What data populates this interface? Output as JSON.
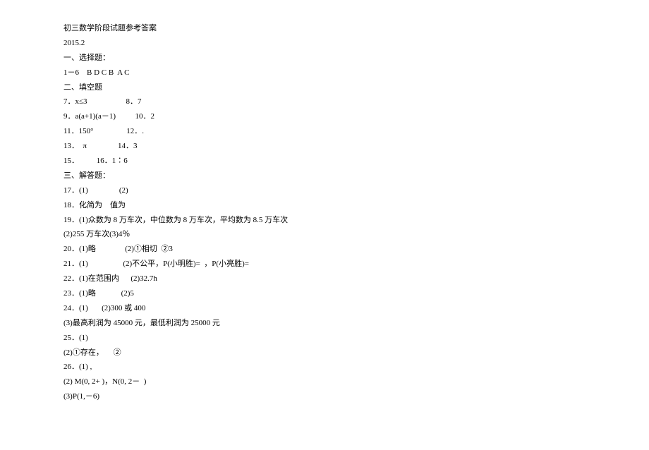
{
  "lines": [
    "初三数学阶段试题参考答案",
    "2015.2",
    "一、选择题：",
    "1－6    B D C B  A C",
    "二、填空题",
    "7．x≤3                    8．7",
    "9．a(a+1)(a－1)          10．2",
    "11．150°                 12．.",
    "13．  π                14．3",
    "15．         16．1∶6",
    "三、解答题：",
    "17．(1)                (2)",
    "18．化简为    值为",
    "19．(1)众数为 8 万车次，中位数为 8 万车次，平均数为 8.5 万车次",
    "(2)255 万车次(3)4％",
    "20．(1)略               (2)①相切  ②3",
    "21．(1)                  (2)不公平，P(小明胜)=  ，P(小亮胜)=",
    "22．(1)在范围内      (2)32.7h",
    "23．(1)略             (2)5",
    "24．(1)       (2)300 或 400",
    "(3)最高利润为 45000 元，最低利润为 25000 元",
    "25．(1)",
    "(2)①存在，     ②",
    "26．(1) ,",
    "(2) M(0, 2+ )，N(0, 2－  )",
    "(3)P(1,－6)"
  ]
}
